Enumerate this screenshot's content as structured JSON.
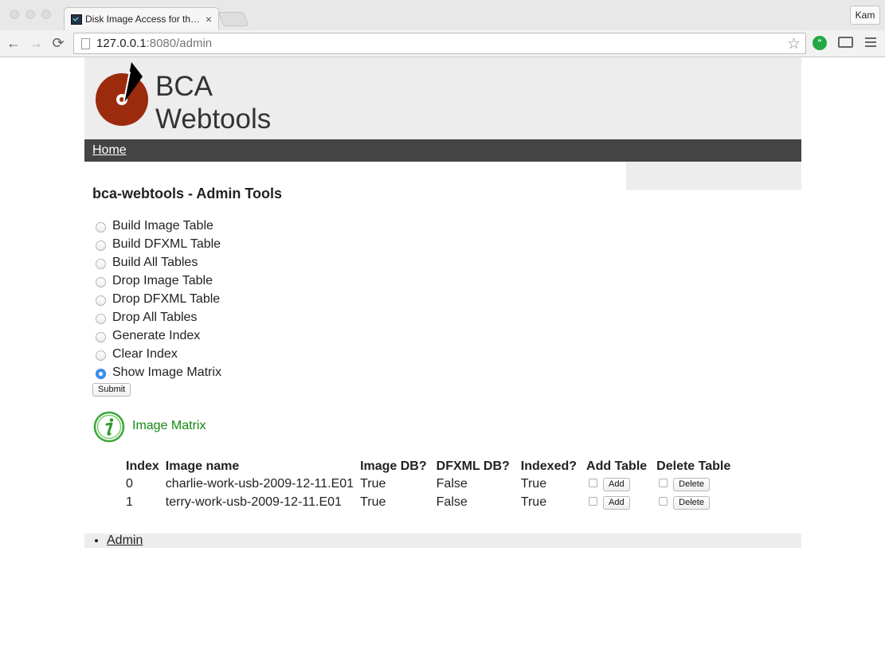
{
  "browser": {
    "tab_title": "Disk Image Access for the Web",
    "tab_close": "×",
    "profile": "Kam",
    "url_host": "127.0.0.1",
    "url_rest": ":8080/admin",
    "back_glyph": "←",
    "forward_glyph": "→",
    "reload_glyph": "⟳",
    "star_glyph": "☆"
  },
  "site": {
    "name_line1": "BCA",
    "name_line2": "Webtools",
    "logo_color": "#9c2b0d"
  },
  "nav": {
    "home": "Home"
  },
  "page_title": "bca-webtools - Admin Tools",
  "admin_form": {
    "options": [
      {
        "label": "Build Image Table",
        "checked": false
      },
      {
        "label": "Build DFXML Table",
        "checked": false
      },
      {
        "label": "Build All Tables",
        "checked": false
      },
      {
        "label": "Drop Image Table",
        "checked": false
      },
      {
        "label": "Drop DFXML Table",
        "checked": false
      },
      {
        "label": "Drop All Tables",
        "checked": false
      },
      {
        "label": "Generate Index",
        "checked": false
      },
      {
        "label": "Clear Index",
        "checked": false
      },
      {
        "label": "Show Image Matrix",
        "checked": true
      }
    ],
    "submit_label": "Submit"
  },
  "matrix": {
    "title": "Image Matrix",
    "headers": [
      "Index",
      "Image name",
      "Image DB?",
      "DFXML DB?",
      "Indexed?",
      "Add Table",
      "Delete Table"
    ],
    "rows": [
      {
        "index": "0",
        "name": "charlie-work-usb-2009-12-11.E01",
        "image_db": "True",
        "dfxml_db": "False",
        "indexed": "True",
        "add_label": "Add",
        "delete_label": "Delete"
      },
      {
        "index": "1",
        "name": "terry-work-usb-2009-12-11.E01",
        "image_db": "True",
        "dfxml_db": "False",
        "indexed": "True",
        "add_label": "Add",
        "delete_label": "Delete"
      }
    ]
  },
  "footer": {
    "links": [
      "Admin"
    ]
  },
  "colors": {
    "nav_bg": "#444444",
    "header_bg": "#ededed",
    "info_green": "#138a13",
    "radio_selected": "#3b8ef0"
  }
}
